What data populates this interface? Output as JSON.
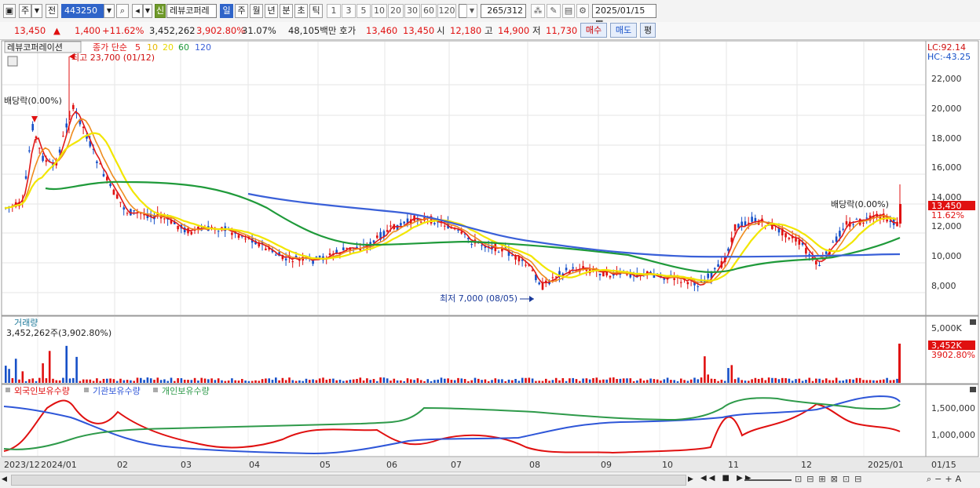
{
  "toolbar": {
    "market": "주",
    "scope": "전",
    "code": "443250",
    "new_badge": "신",
    "stock_name": "레뷰코퍼레",
    "periods": [
      "일",
      "주",
      "월",
      "년",
      "분",
      "초",
      "틱"
    ],
    "intervals": [
      "1",
      "3",
      "5",
      "10",
      "20",
      "30",
      "60",
      "120"
    ],
    "count_value": "265",
    "count_total": "/312",
    "date": "2025/01/15"
  },
  "quote": {
    "price": "13,450",
    "change_arrow": "▲",
    "change": "1,400",
    "change_pct": "+11.62%",
    "volume": "3,452,262",
    "volume_ratio": "3,902.80%",
    "turnover": "31.07%",
    "amount": "48,105백만",
    "ask_label": "호가",
    "ask1": "13,460",
    "ask2": "13,450",
    "open_label": "시",
    "open": "12,180",
    "high_label": "고",
    "high": "14,900",
    "low_label": "저",
    "low": "11,730",
    "buy_btn": "매수",
    "sell_btn": "매도",
    "eval_btn": "평"
  },
  "colors": {
    "up": "#e01010",
    "down": "#1650c8",
    "ma5": "#e01818",
    "ma10": "#ee8c1e",
    "ma20": "#f2e600",
    "ma60": "#1f9a3a",
    "ma120": "#3a60d8",
    "foreign": "#e01010",
    "institution": "#2e56d8",
    "individual": "#2e9a4a"
  },
  "price_panel": {
    "legend_title": "레뷰코퍼레이션",
    "legend_ma_label": "종가 단순",
    "ma_periods": [
      "5",
      "10",
      "20",
      "60",
      "120"
    ],
    "high_annot": "최고 23,700 (01/12)",
    "low_annot": "최저 7,000 (08/05)",
    "dividend_left": "배당락(0.00%)",
    "dividend_right": "배당락(0.00%)",
    "lc": "LC:92.14",
    "hc": "HC:-43.25",
    "current_price": "13,450",
    "current_pct": "11.62%",
    "y_ticks": [
      "22,000",
      "20,000",
      "18,000",
      "16,000",
      "14,000",
      "12,000",
      "10,000",
      "8,000"
    ]
  },
  "volume_panel": {
    "title": "거래량",
    "value_text": "3,452,262주(3,902.80%)",
    "y_tick": "5,000K",
    "current": "3,452K",
    "current_pct": "3902.80%"
  },
  "investor_panel": {
    "series": [
      "외국인보유수량",
      "기관보유수량",
      "개인보유수량"
    ],
    "y_ticks": [
      "1,500,000",
      "1,000,000"
    ]
  },
  "x_axis": {
    "labels": [
      "2023/12",
      "2024/01",
      "02",
      "03",
      "04",
      "05",
      "06",
      "07",
      "08",
      "09",
      "10",
      "11",
      "12",
      "2025/01"
    ],
    "end_label": "01/15"
  }
}
